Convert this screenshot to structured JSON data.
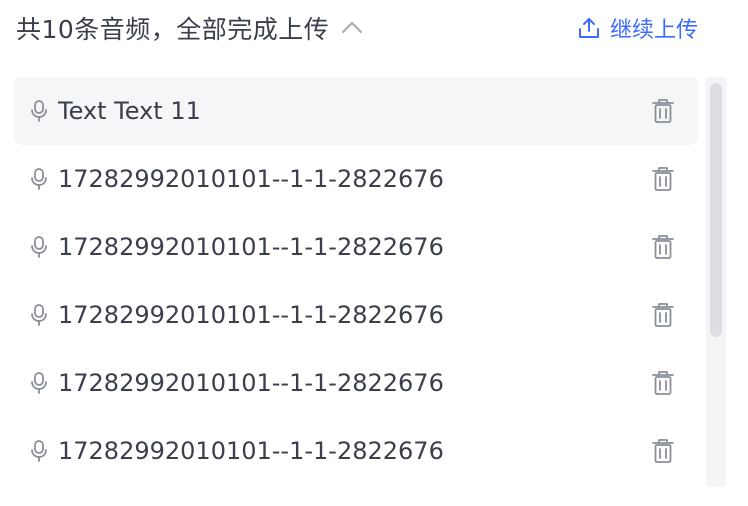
{
  "header": {
    "summary": "共10条音频，全部完成上传",
    "continue_label": "继续上传"
  },
  "icons": {
    "collapse": "chevron-up-icon",
    "upload": "upload-icon",
    "item": "microphone-icon",
    "delete": "trash-icon"
  },
  "colors": {
    "accent": "#3d6bff",
    "text": "#3a3f4b",
    "icon": "#8a8f99",
    "active_row": "#f5f6f8"
  },
  "files": [
    {
      "name": "Text Text 11"
    },
    {
      "name": "17282992010101--1-1-2822676"
    },
    {
      "name": "17282992010101--1-1-2822676"
    },
    {
      "name": "17282992010101--1-1-2822676"
    },
    {
      "name": "17282992010101--1-1-2822676"
    },
    {
      "name": "17282992010101--1-1-2822676"
    }
  ]
}
